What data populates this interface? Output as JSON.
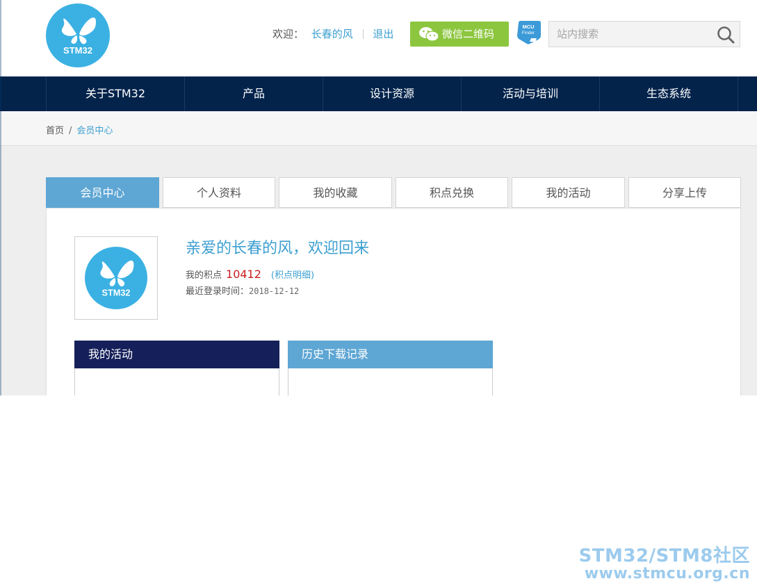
{
  "header": {
    "logo_text": "STM32",
    "welcome_label": "欢迎：",
    "username": "长春的风",
    "logout": "退出",
    "wechat_button": "微信二维码",
    "mcu_finder": "MCU Finder",
    "search_placeholder": "站内搜索"
  },
  "nav": {
    "items": [
      "关于STM32",
      "产品",
      "设计资源",
      "活动与培训",
      "生态系统"
    ]
  },
  "breadcrumb": {
    "home": "首页",
    "separator": "/",
    "current": "会员中心"
  },
  "tabs": [
    "会员中心",
    "个人资料",
    "我的收藏",
    "积点兑换",
    "我的活动",
    "分享上传"
  ],
  "active_tab": "会员中心",
  "profile": {
    "greeting": "亲爱的长春的风，欢迎回来",
    "points_label": "我的积点",
    "points_value": "10412",
    "points_detail_link": "积点明细",
    "last_login_label": "最近登录时间：",
    "last_login_date": "2018-12-12"
  },
  "boxes": {
    "activities_title": "我的活动",
    "downloads_title": "历史下载记录"
  },
  "watermark": {
    "line1": "STM32/STM8社区",
    "line2": "www.stmcu.org.cn"
  },
  "colors": {
    "nav_bg": "#03234b",
    "accent_blue": "#3d9fd0",
    "tab_active": "#5ea6d4",
    "wechat_green": "#8cc63f",
    "points_red": "#c81e1e",
    "box_dark": "#15205a"
  }
}
